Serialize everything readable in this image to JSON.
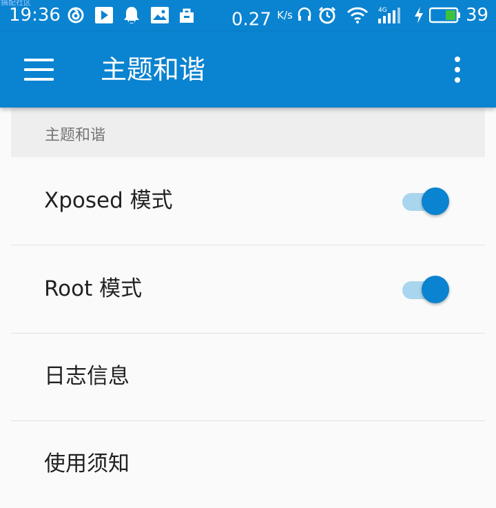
{
  "status_bar": {
    "watermark": "搞配社区",
    "time": "19:36",
    "net_speed": "0.27",
    "net_speed_unit": "K/s",
    "network_type": "4G",
    "battery_level": "39",
    "icons": [
      "netease-icon",
      "play-icon",
      "qq-icon",
      "gallery-icon",
      "bag-icon",
      "headset-icon",
      "alarm-icon",
      "wifi-icon",
      "signal-icon",
      "charging-icon",
      "battery-icon"
    ]
  },
  "toolbar": {
    "title": "主题和谐",
    "menu_icon": "hamburger-menu-icon",
    "overflow_icon": "more-vert-icon"
  },
  "section": {
    "header": "主题和谐"
  },
  "preferences": [
    {
      "label": "Xposed 模式",
      "switch": true,
      "checked": true
    },
    {
      "label": "Root 模式",
      "switch": true,
      "checked": true
    },
    {
      "label": "日志信息",
      "switch": false
    },
    {
      "label": "使用须知",
      "switch": false
    }
  ],
  "colors": {
    "primary": "#0a83d0",
    "switch_track": "#a9d6ee",
    "background": "#fafafa",
    "section_bg": "#eeeeee"
  }
}
